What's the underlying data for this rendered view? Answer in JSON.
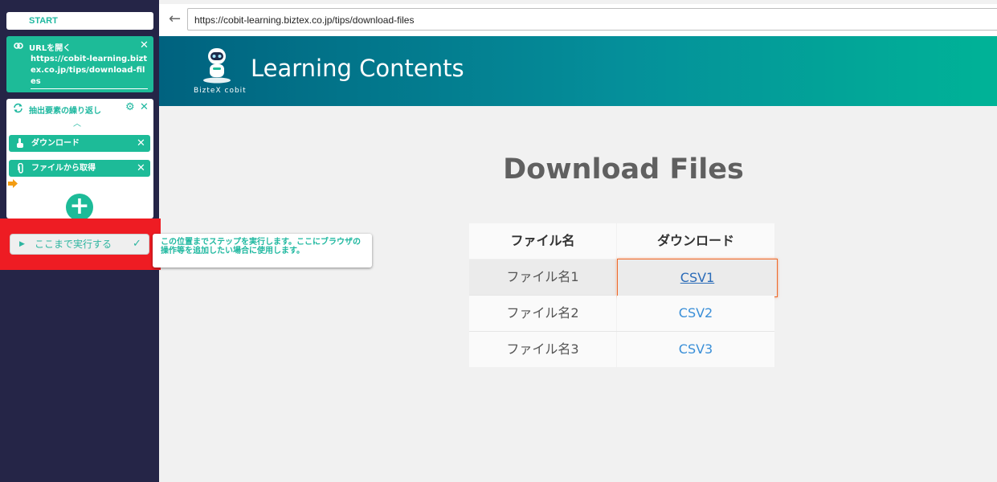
{
  "browser": {
    "url": "https://cobit-learning.biztex.co.jp/tips/download-files"
  },
  "banner": {
    "title": "Learning Contents",
    "brand": "BizteX cobit"
  },
  "page": {
    "heading": "Download Files"
  },
  "table": {
    "headers": [
      "ファイル名",
      "ダウンロード"
    ],
    "rows": [
      {
        "name": "ファイル名1",
        "link": "CSV1"
      },
      {
        "name": "ファイル名2",
        "link": "CSV2"
      },
      {
        "name": "ファイル名3",
        "link": "CSV3"
      }
    ]
  },
  "sidebar": {
    "start_label": "START",
    "url_step": {
      "title": "URLを開く",
      "value": "https://cobit-learning.biztex.co.jp/tips/download-files"
    },
    "loop_step": {
      "title": "抽出要素の繰り返し"
    },
    "children": [
      {
        "label": "ダウンロード"
      },
      {
        "label": "ファイルから取得"
      }
    ],
    "run_button_label": "ここまで実行する",
    "tooltip_text": "この位置までステップを実行します。ここにブラウザの操作等を追加したい場合に使用します。"
  },
  "colors": {
    "accent": "#1dbb98",
    "sidebar": "#252547",
    "highlight": "#ee1c23",
    "link": "#3a8fd8"
  }
}
